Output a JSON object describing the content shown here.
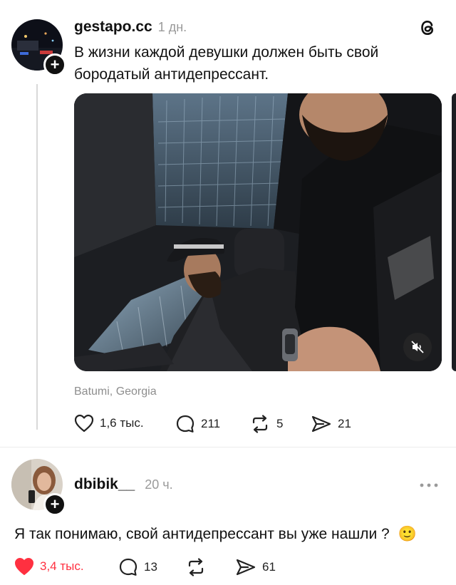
{
  "post": {
    "username": "gestapo.cc",
    "time": "1 дн.",
    "text_line1": "В жизни каждой девушки должен быть свой",
    "text_line2": "бородатый антидепрессант.",
    "location": "Batumi, Georgia",
    "likes": "1,6 тыс.",
    "comments": "211",
    "reposts": "5",
    "shares": "21"
  },
  "reply": {
    "username": "dbibik__",
    "time": "20 ч.",
    "text": "Я так понимаю, свой антидепрессант вы уже нашли ?",
    "emoji": "🙂",
    "likes": "3,4 тыс.",
    "comments": "13",
    "shares": "61"
  },
  "colors": {
    "like_active": "#ff3040",
    "muted_text": "#9a9a9a"
  },
  "icons": {
    "app_logo": "threads-logo-icon",
    "mute": "muted-speaker-icon",
    "more": "more-horizontal-icon"
  }
}
